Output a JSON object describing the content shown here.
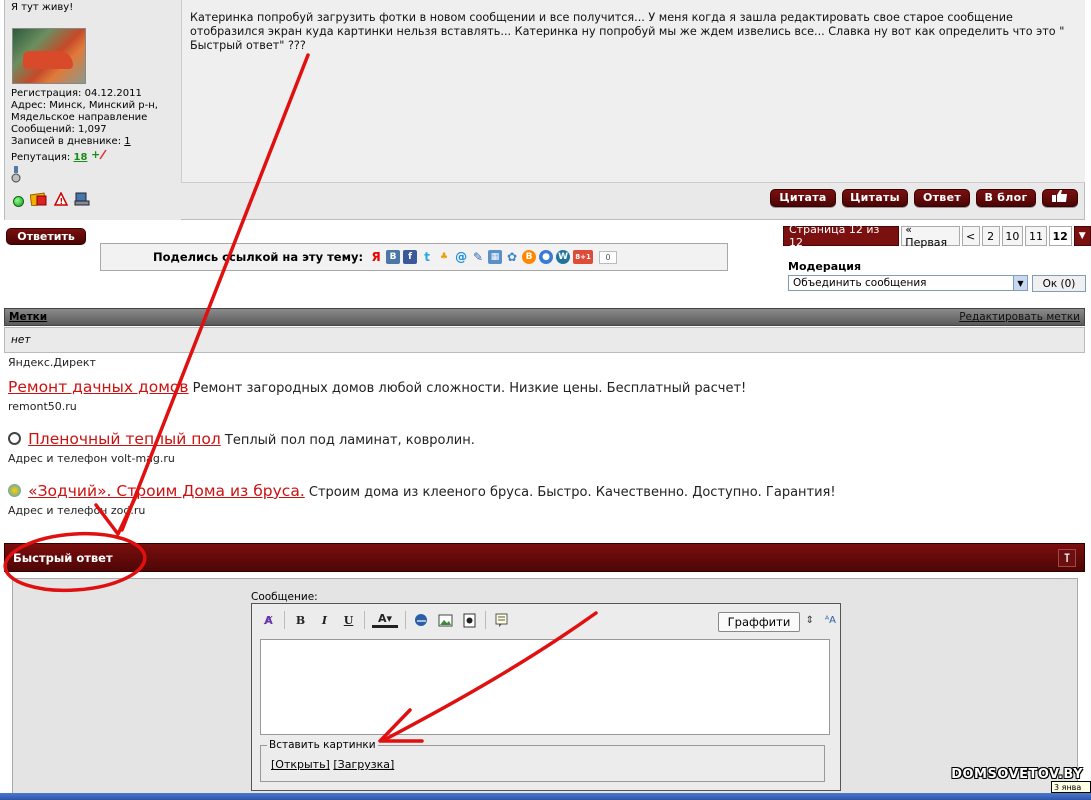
{
  "user": {
    "title": "Я тут живу!",
    "registration": "Регистрация: 04.12.2011",
    "address_line1": "Адрес: Минск, Минский р-н,",
    "address_line2": "Мядельское направление",
    "posts": "Сообщений: 1,097",
    "diary_label": "Записей в дневнике:",
    "diary_count": "1",
    "rep_label": "Репутация:",
    "rep_value": "18"
  },
  "post": {
    "text": "Катеринка попробуй загрузить фотки в новом сообщении и все получится... У меня когда я зашла редактировать свое старое сообщение отобразился экран куда картинки нельзя вставлять... Катеринка ну попробуй мы же ждем извелись все... Славка ну вот как определить что это \" Быстрый ответ\" ???",
    "buttons": [
      "Цитата",
      "Цитаты",
      "Ответ",
      "В блог"
    ]
  },
  "reply_button": "Ответить",
  "share": {
    "label": "Поделись ссылкой на эту тему:",
    "count": "0",
    "plusone": "8+1"
  },
  "pagination": {
    "label": "Страница 12 из 12",
    "first": "« Первая",
    "prev": "<",
    "pages": [
      "2",
      "10",
      "11"
    ],
    "current": "12"
  },
  "moderation": {
    "label": "Модерация",
    "selected": "Объединить сообщения",
    "ok": "Ок (0)"
  },
  "tags": {
    "header": "Метки",
    "edit": "Редактировать метки",
    "value": "нет"
  },
  "direct": {
    "title": "Яндекс.Директ",
    "ads": [
      {
        "title": "Ремонт дачных домов",
        "text": "Ремонт загородных домов любой сложности. Низкие цены. Бесплатный расчет!",
        "url": "remont50.ru"
      },
      {
        "title": "Пленочный теплый пол",
        "text": "Теплый пол под ламинат, ковролин.",
        "url": "Адрес и телефон  volt-mag.ru"
      },
      {
        "title": "«Зодчий». Строим Дома из бруса.",
        "text": "Строим дома из клееного бруса. Быстро. Качественно. Доступно. Гарантия!",
        "url": "Адрес и телефон  zod.ru"
      }
    ]
  },
  "quick_reply": {
    "title": "Быстрый ответ",
    "message_label": "Сообщение:",
    "graffiti": "Граффити",
    "insert_pictures": "Вставить картинки",
    "open": "[Открыть]",
    "upload": "[Загрузка]"
  },
  "watermark": "DOMSOVETOV.BY",
  "tray_date": "3 янва",
  "colors": {
    "brand_dark_red": "#5a0808",
    "annotation_red": "#e01010"
  }
}
